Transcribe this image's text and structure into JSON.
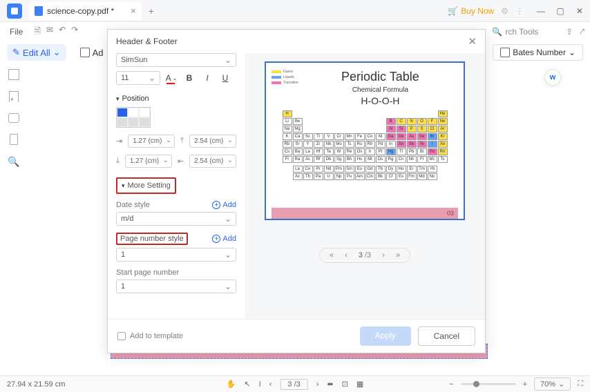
{
  "titlebar": {
    "tab_title": "science-copy.pdf *",
    "buy_now": "Buy Now"
  },
  "toolbar": {
    "file": "File",
    "search_tools": "rch Tools",
    "edit_all": "Edit All",
    "add": "Ad",
    "bates": "Bates Number"
  },
  "dialog": {
    "title": "Header & Footer",
    "font_family": "SimSun",
    "font_size": "11",
    "position_label": "Position",
    "margins": {
      "top": "1.27 (cm)",
      "right": "2.54 (cm)",
      "bottom": "1.27 (cm)",
      "left": "2.54 (cm)"
    },
    "more_setting": "More Setting",
    "date_style_label": "Date style",
    "date_style_value": "m/d",
    "add_label": "Add",
    "page_number_style_label": "Page number style",
    "page_number_style_value": "1",
    "start_page_label": "Start page number",
    "start_page_value": "1",
    "add_to_template": "Add to template",
    "apply": "Apply",
    "cancel": "Cancel",
    "pager": {
      "cur": "3",
      "total": "/3"
    }
  },
  "preview": {
    "title": "Periodic Table",
    "subtitle": "Chemical Formula",
    "formula": "H-O-O-H",
    "page_no": "03"
  },
  "statusbar": {
    "dims": "27.94 x 21.59 cm",
    "page_cur": "3",
    "page_total": "/3",
    "zoom": "70%"
  },
  "float_badge": "w"
}
